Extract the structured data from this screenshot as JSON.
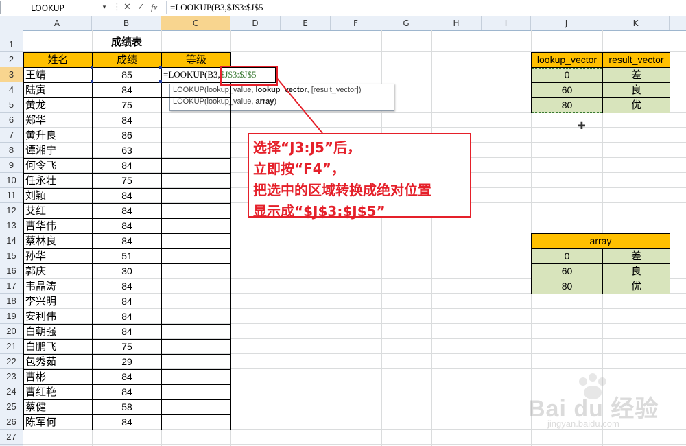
{
  "formula_bar": {
    "name_box": "LOOKUP",
    "name_box_arrow": "▾",
    "cancel_icon": "✕",
    "enter_icon": "✓",
    "fx_icon": "fx",
    "formula": "=LOOKUP(B3,$J$3:$J$5"
  },
  "columns": [
    "A",
    "B",
    "C",
    "D",
    "E",
    "F",
    "G",
    "H",
    "I",
    "J",
    "K"
  ],
  "rows": [
    "1",
    "2",
    "3",
    "4",
    "5",
    "6",
    "7",
    "8",
    "9",
    "10",
    "11",
    "12",
    "13",
    "14",
    "15",
    "16",
    "17",
    "18",
    "19",
    "20",
    "21",
    "22",
    "23",
    "24",
    "25",
    "26",
    "27"
  ],
  "sheet": {
    "title": "成绩表",
    "headers": [
      "姓名",
      "成绩",
      "等级"
    ],
    "edit_cell_prefix": "=LOOKUP(B3,",
    "edit_cell_ref": "$J$3:$J$5",
    "students": [
      {
        "name": "王靖",
        "score": "85"
      },
      {
        "name": "陆寅",
        "score": "84"
      },
      {
        "name": "黄龙",
        "score": "75"
      },
      {
        "name": "郑华",
        "score": "84"
      },
      {
        "name": "黄升良",
        "score": "86"
      },
      {
        "name": "谭湘宁",
        "score": "63"
      },
      {
        "name": "何令飞",
        "score": "84"
      },
      {
        "name": "任永壮",
        "score": "75"
      },
      {
        "name": "刘颖",
        "score": "84"
      },
      {
        "name": "艾红",
        "score": "84"
      },
      {
        "name": "曹华伟",
        "score": "84"
      },
      {
        "name": "蔡林良",
        "score": "84"
      },
      {
        "name": "孙华",
        "score": "51"
      },
      {
        "name": "郭庆",
        "score": "30"
      },
      {
        "name": "韦晶涛",
        "score": "84"
      },
      {
        "name": "李兴明",
        "score": "84"
      },
      {
        "name": "安利伟",
        "score": "84"
      },
      {
        "name": "白朝强",
        "score": "84"
      },
      {
        "name": "白鹏飞",
        "score": "75"
      },
      {
        "name": "包秀茹",
        "score": "29"
      },
      {
        "name": "曹彬",
        "score": "84"
      },
      {
        "name": "曹红艳",
        "score": "84"
      },
      {
        "name": "蔡健",
        "score": "58"
      },
      {
        "name": "陈军何",
        "score": "84"
      }
    ]
  },
  "tooltip": {
    "line1_pre": "LOOKUP(lookup_value, ",
    "line1_bold": "lookup_vector",
    "line1_post": ", [result_vector])",
    "line2_pre": "LOOKUP(lookup_value, ",
    "line2_bold": "array",
    "line2_post": ")"
  },
  "lookup_table": {
    "headers": [
      "lookup_vector",
      "result_vector"
    ],
    "rows": [
      [
        "0",
        "差"
      ],
      [
        "60",
        "良"
      ],
      [
        "80",
        "优"
      ]
    ]
  },
  "array_table": {
    "header": "array",
    "rows": [
      [
        "0",
        "差"
      ],
      [
        "60",
        "良"
      ],
      [
        "80",
        "优"
      ]
    ]
  },
  "callout": {
    "lines": [
      "选择“J3:J5”后，",
      "立即按“F4”，",
      "把选中的区域转换成绝对位置",
      "显示成“$J$3:$J$5”"
    ]
  },
  "watermark": {
    "logo": "Bai du 经验",
    "url": "jingyan.baidu.com"
  },
  "colors": {
    "header_orange": "#ffc000",
    "table_green": "#d8e4bc",
    "callout_red": "#e5202a",
    "ref_green": "#3a7a33"
  }
}
